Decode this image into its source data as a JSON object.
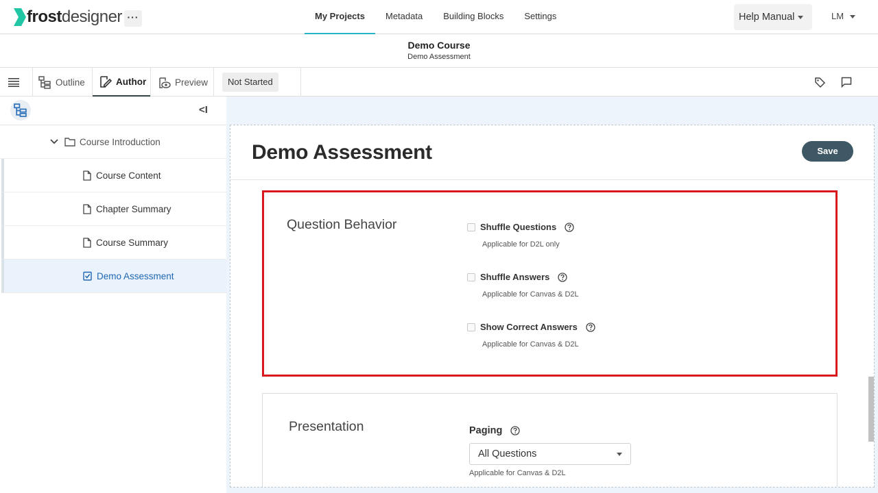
{
  "app": {
    "logo_bold": "frost",
    "logo_light": "designer",
    "more_label": "···"
  },
  "nav": {
    "tabs": [
      {
        "label": "My Projects",
        "active": true
      },
      {
        "label": "Metadata"
      },
      {
        "label": "Building Blocks"
      },
      {
        "label": "Settings"
      }
    ],
    "help_label": "Help Manual",
    "user_initials": "LM"
  },
  "course": {
    "title": "Demo Course",
    "subtitle": "Demo Assessment"
  },
  "toolbar": {
    "outline_label": "Outline",
    "author_label": "Author",
    "preview_label": "Preview",
    "status_label": "Not Started"
  },
  "sidebar": {
    "collapse_label": "<I",
    "folder": "Course Introduction",
    "items": [
      {
        "label": "Course Content",
        "icon": "page-icon"
      },
      {
        "label": "Chapter Summary",
        "icon": "page-icon"
      },
      {
        "label": "Course Summary",
        "icon": "page-icon"
      },
      {
        "label": "Demo Assessment",
        "icon": "checkbox-page-icon",
        "active": true
      }
    ]
  },
  "editor": {
    "title": "Demo Assessment",
    "save_label": "Save",
    "question_behavior": {
      "title": "Question Behavior",
      "options": [
        {
          "label": "Shuffle Questions",
          "note": "Applicable for D2L only",
          "checked": false
        },
        {
          "label": "Shuffle Answers",
          "note": "Applicable for Canvas & D2L",
          "checked": false
        },
        {
          "label": "Show Correct Answers",
          "note": "Applicable for Canvas & D2L",
          "checked": false
        }
      ]
    },
    "presentation": {
      "title": "Presentation",
      "paging_label": "Paging",
      "paging_value": "All Questions",
      "paging_note": "Applicable for Canvas & D2L"
    }
  },
  "colors": {
    "accent": "#26b5c8",
    "save_button": "#3e5866",
    "highlight_border": "#d9161c",
    "active_item": "#1f66b3"
  }
}
